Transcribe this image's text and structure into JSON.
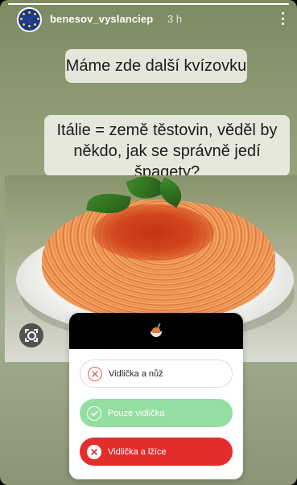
{
  "story": {
    "username": "benesov_vyslanciep",
    "time": "3 h",
    "progress": 1.0
  },
  "captions": {
    "line1": "Máme zde další kvízovku",
    "line2a": "Itálie = země těstovin, věděl by",
    "line2b": "někdo, jak se správně jedí špagety?"
  },
  "quiz": {
    "header_icon": "spaghetti-emoji",
    "options": [
      {
        "label": "Vidlička a nůž",
        "state": "not-selected",
        "icon": "x-circle-icon"
      },
      {
        "label": "Pouze vidlička",
        "state": "correct",
        "icon": "check-circle-icon"
      },
      {
        "label": "Vidlička a lžíce",
        "state": "selected-wrong",
        "icon": "x-circle-icon"
      }
    ]
  },
  "colors": {
    "correct": "#95dea1",
    "wrong": "#e32c2c",
    "wrong_outline": "#e0665e"
  },
  "icons": {
    "more": "more-vertical-icon",
    "lens": "lens-scan-icon"
  }
}
